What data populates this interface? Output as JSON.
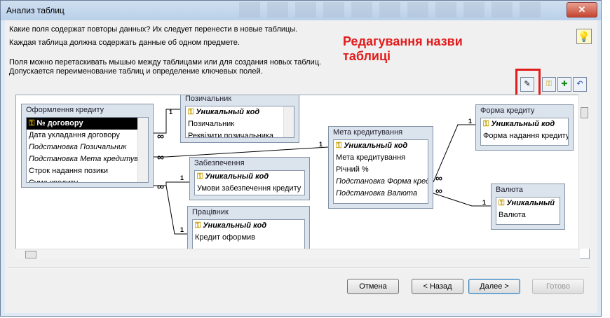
{
  "window": {
    "title": "Анализ таблиц"
  },
  "instructions": {
    "line1": "Какие поля содержат повторы данных? Их следует перенести в новые таблицы.",
    "line2": "Каждая таблица должна содержать данные об одном предмете.",
    "line3": "Поля можно перетаскивать мышью между таблицами или для создания новых таблиц.",
    "line4": "Допускается переименование таблиц и определение ключевых полей."
  },
  "annotation": {
    "line1": "Редагування назви",
    "line2": "таблиці"
  },
  "toolbar": {
    "rename_icon": "rename-table-icon",
    "key_icon": "key-icon",
    "add_key_icon": "add-key-icon",
    "undo_icon": "undo-icon"
  },
  "tables": {
    "main": {
      "title": "Оформлення кредиту",
      "fields": [
        "№ договору",
        "Дата укладання договору",
        "Подстановка Позичальник",
        "Подстановка Мета кредитува",
        "Строк надання позики",
        "Сума кредиту"
      ]
    },
    "borrower": {
      "title": "Позичальник",
      "fields": [
        "Уникальный код",
        "Позичальник",
        "Реквізити позичальника"
      ]
    },
    "collateral": {
      "title": "Забезпечення",
      "fields": [
        "Уникальный код",
        "Умови забезпечення кредиту"
      ]
    },
    "employee": {
      "title": "Працівник",
      "fields": [
        "Уникальный код",
        "Кредит оформив"
      ]
    },
    "purpose": {
      "title": "Мета кредитування",
      "fields": [
        "Уникальный код",
        "Мета кредитування",
        "Річний %",
        "Подстановка Форма кред",
        "Подстановка Валюта"
      ]
    },
    "form": {
      "title": "Форма кредиту",
      "fields": [
        "Уникальный код",
        "Форма надання кредиту"
      ]
    },
    "currency": {
      "title": "Валюта",
      "fields": [
        "Уникальный",
        "Валюта"
      ]
    }
  },
  "relation_labels": {
    "one": "1",
    "many": "∞"
  },
  "buttons": {
    "cancel": "Отмена",
    "back": "< Назад",
    "next": "Далее >",
    "finish": "Готово"
  },
  "colors": {
    "annotation": "#e21c1c"
  }
}
